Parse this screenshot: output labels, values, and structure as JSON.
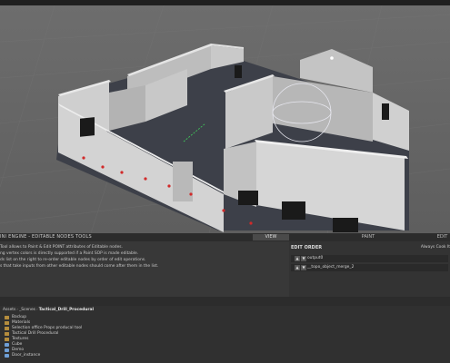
{
  "panel": {
    "title": "INI ENGINE - EDITABLE NODES TOOLS",
    "tabs": [
      {
        "label": "VIEW"
      },
      {
        "label": "PAINT"
      },
      {
        "label": "EDIT"
      }
    ],
    "description": [
      "Tool allows to Paint & Edit POINT attributes of Editable nodes.",
      "ng vertex colors is directly supported if a Paint SOP is made editable.",
      "ds list on the right to re-order editable nodes by order of edit operations.",
      "s that take inputs from other editable nodes should come after them in the list."
    ],
    "edit_order": {
      "title": "EDIT ORDER",
      "link": "Always Cook It",
      "items": [
        {
          "label": "output0"
        },
        {
          "label": "__topo_object_merge_2"
        }
      ]
    }
  },
  "project": {
    "breadcrumb": [
      "Assets",
      "_Scenes",
      "Tactical_Drill_Procedural"
    ],
    "items": [
      {
        "label": "Backup",
        "icon": "folder-icon"
      },
      {
        "label": "Materials",
        "icon": "folder-icon"
      },
      {
        "label": "Selection office Props producal tool",
        "icon": "folder-icon"
      },
      {
        "label": "Tactical Drill Procedural",
        "icon": "folder-icon"
      },
      {
        "label": "Textures",
        "icon": "folder-icon"
      },
      {
        "label": "Cube",
        "icon": "asset-icon"
      },
      {
        "label": "Demo",
        "icon": "asset-icon"
      },
      {
        "label": "Door_instance",
        "icon": "asset-icon"
      }
    ]
  },
  "colors": {
    "viewport_bg": "#676767",
    "wall_top": "#d8d8d8",
    "floor": "#3a3d48",
    "vertex_point": "#d12a2a",
    "gizmo": "#e7e7ef"
  }
}
